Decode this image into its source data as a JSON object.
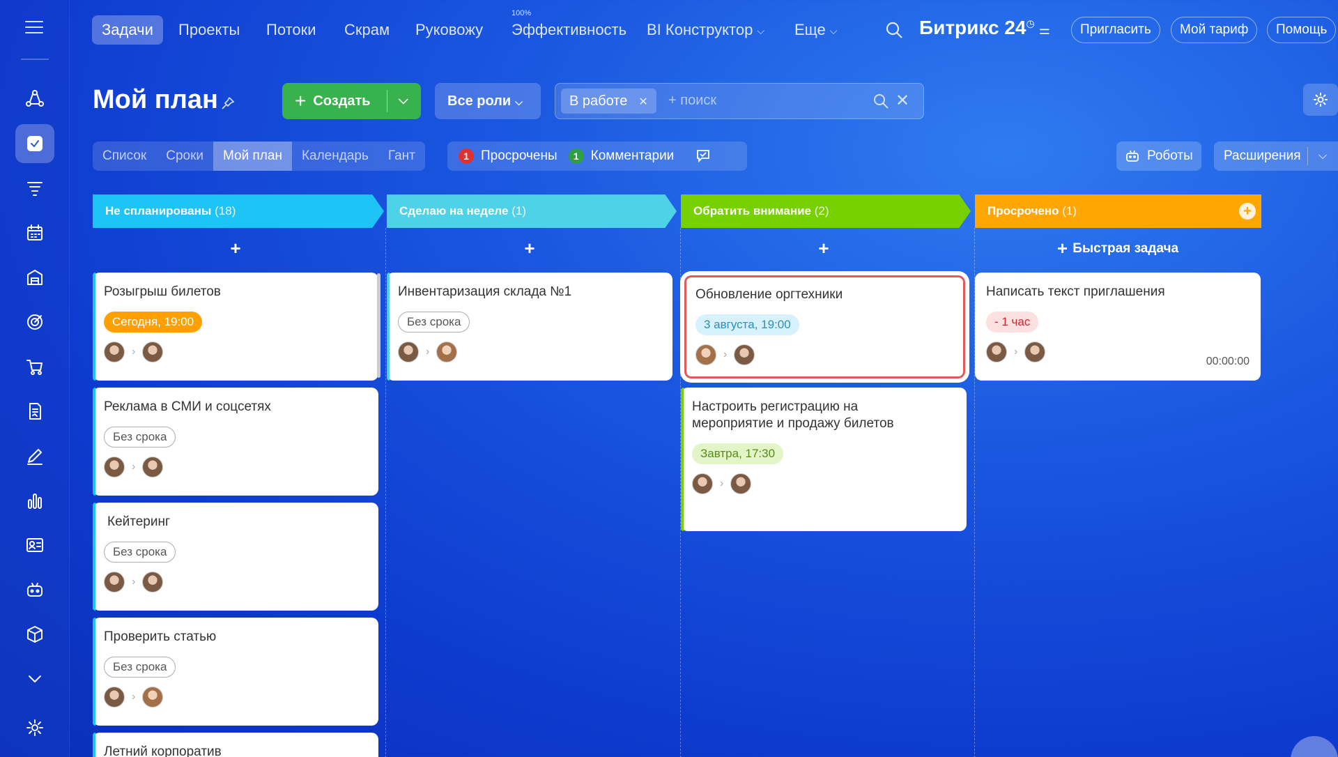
{
  "nav": {
    "items": [
      {
        "label": "Задачи",
        "active": true
      },
      {
        "label": "Проекты"
      },
      {
        "label": "Потоки"
      },
      {
        "label": "Скрам"
      },
      {
        "label": "Руковожу"
      },
      {
        "label": "Эффективность",
        "sup": "100%"
      },
      {
        "label": "BI Конструктор",
        "dropdown": true
      },
      {
        "label": "Еще",
        "dropdown": true
      }
    ],
    "brand": "Битрикс 24",
    "invite": "Пригласить",
    "tariff": "Мой тариф",
    "help": "Помощь"
  },
  "header": {
    "title": "Мой план",
    "create": "Создать",
    "roles": "Все роли",
    "filter_chip": "В работе",
    "search_placeholder": "+ поиск"
  },
  "views": {
    "tabs": [
      "Список",
      "Сроки",
      "Мой план",
      "Календарь",
      "Гант"
    ],
    "active": "Мой план",
    "overdue_count": "1",
    "overdue_label": "Просрочены",
    "comments_count": "1",
    "comments_label": "Комментарии",
    "robots": "Роботы",
    "extensions": "Расширения"
  },
  "columns": [
    {
      "title": "Не спланированы",
      "count": "(18)",
      "color": "#1ec4f5",
      "add": "+"
    },
    {
      "title": "Сделаю на неделе",
      "count": "(1)",
      "color": "#4dd2e8",
      "add": "+"
    },
    {
      "title": "Обратить внимание",
      "count": "(2)",
      "color": "#77d100",
      "add": "+"
    },
    {
      "title": "Просрочено",
      "count": "(1)",
      "color": "#ffa600",
      "add": "+",
      "quick": "Быстрая задача"
    }
  ],
  "cards": {
    "c1": {
      "title": "Розыгрыш билетов",
      "badge": "Сегодня, 19:00"
    },
    "c2": {
      "title": "Реклама в СМИ и соцсетях",
      "badge": "Без срока"
    },
    "c3": {
      "title": "Кейтеринг",
      "badge": "Без срока"
    },
    "c4": {
      "title": "Проверить статью",
      "badge": "Без срока"
    },
    "c5": {
      "title": "Летний корпоратив"
    },
    "w1": {
      "title": "Инвентаризация склада №1",
      "badge": "Без срока"
    },
    "a1": {
      "title": "Обновление оргтехники",
      "badge": "3 августа, 19:00"
    },
    "a2": {
      "title": "Настроить регистрацию на мероприятие и продажу билетов",
      "badge": "Завтра, 17:30"
    },
    "o1": {
      "title": "Написать текст приглашения",
      "badge": "- 1 час",
      "timer": "00:00:00"
    }
  }
}
